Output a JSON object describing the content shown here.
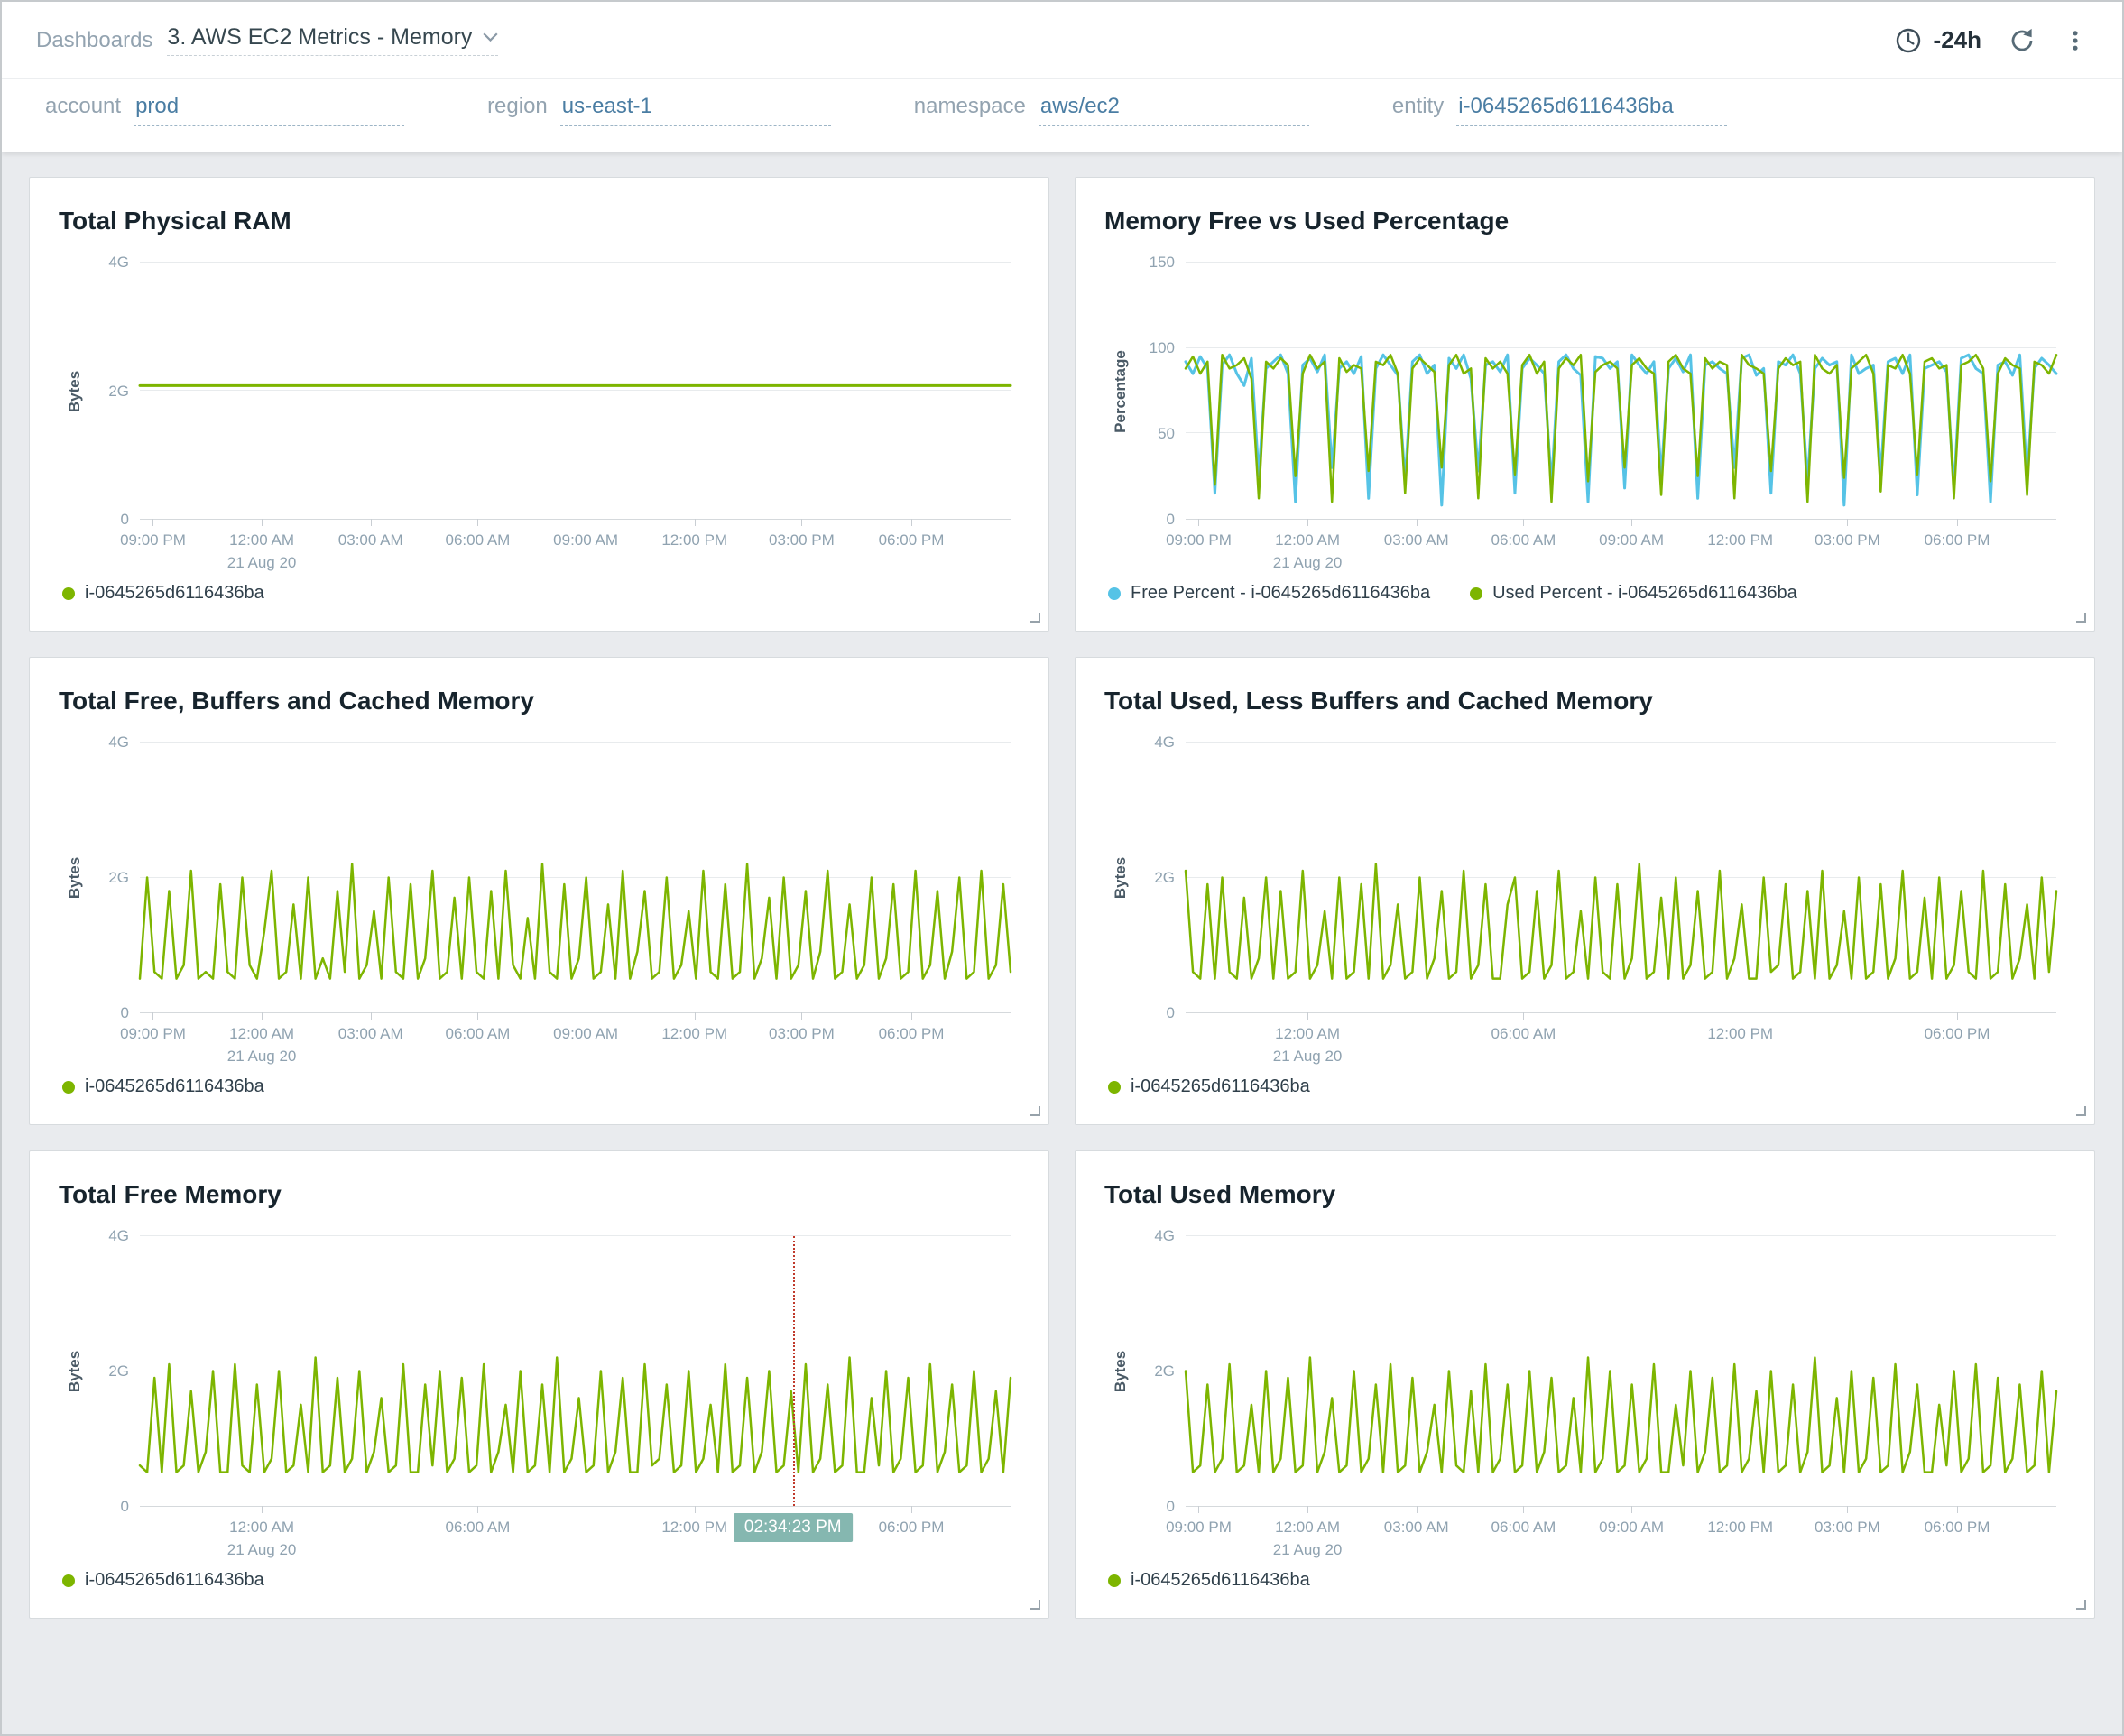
{
  "topbar": {
    "breadcrumb": "Dashboards",
    "dashboard_title": "3. AWS EC2 Metrics - Memory",
    "time_range": "-24h",
    "icons": {
      "time": "clock-icon",
      "refresh": "refresh-icon",
      "menu": "kebab-menu-icon",
      "dropdown": "chevron-down-icon"
    }
  },
  "filters": [
    {
      "label": "account",
      "value": "prod"
    },
    {
      "label": "region",
      "value": "us-east-1"
    },
    {
      "label": "namespace",
      "value": "aws/ec2"
    },
    {
      "label": "entity",
      "value": "i-0645265d6116436ba"
    }
  ],
  "colors": {
    "series_green": "#7db500",
    "series_blue": "#56c3e6",
    "crosshair_red": "#c0392b",
    "tooltip_teal": "#85b7b0",
    "accent_blue": "#4a7da3"
  },
  "chart_data": [
    {
      "type": "line",
      "title": "Total Physical RAM",
      "ylabel": "Bytes",
      "ylim": [
        0,
        4
      ],
      "yticks": [
        {
          "v": 0,
          "label": "0"
        },
        {
          "v": 2,
          "label": "2G"
        },
        {
          "v": 4,
          "label": "4G"
        }
      ],
      "xticks": [
        {
          "frac": 0.015,
          "label": "09:00 PM"
        },
        {
          "frac": 0.14,
          "label": "12:00 AM",
          "sub": "21 Aug 20"
        },
        {
          "frac": 0.265,
          "label": "03:00 AM"
        },
        {
          "frac": 0.388,
          "label": "06:00 AM"
        },
        {
          "frac": 0.512,
          "label": "09:00 AM"
        },
        {
          "frac": 0.637,
          "label": "12:00 PM"
        },
        {
          "frac": 0.76,
          "label": "03:00 PM"
        },
        {
          "frac": 0.886,
          "label": "06:00 PM"
        }
      ],
      "series": [
        {
          "name": "i-0645265d6116436ba",
          "color": "#7db500",
          "width": 3,
          "values": [
            2.08,
            2.08,
            2.08,
            2.08,
            2.08,
            2.08,
            2.08,
            2.08,
            2.08,
            2.08,
            2.08,
            2.08,
            2.08
          ]
        }
      ]
    },
    {
      "type": "line",
      "title": "Memory Free vs Used Percentage",
      "ylabel": "Percentage",
      "ylim": [
        0,
        150
      ],
      "yticks": [
        {
          "v": 0,
          "label": "0"
        },
        {
          "v": 50,
          "label": "50"
        },
        {
          "v": 100,
          "label": "100"
        },
        {
          "v": 150,
          "label": "150"
        }
      ],
      "xticks": [
        {
          "frac": 0.015,
          "label": "09:00 PM"
        },
        {
          "frac": 0.14,
          "label": "12:00 AM",
          "sub": "21 Aug 20"
        },
        {
          "frac": 0.265,
          "label": "03:00 AM"
        },
        {
          "frac": 0.388,
          "label": "06:00 AM"
        },
        {
          "frac": 0.512,
          "label": "09:00 AM"
        },
        {
          "frac": 0.637,
          "label": "12:00 PM"
        },
        {
          "frac": 0.76,
          "label": "03:00 PM"
        },
        {
          "frac": 0.886,
          "label": "06:00 PM"
        }
      ],
      "series": [
        {
          "name": "Free Percent - i-0645265d6116436ba",
          "color": "#56c3e6",
          "width": 3,
          "values": [
            92,
            85,
            95,
            88,
            15,
            90,
            96,
            85,
            78,
            94,
            25,
            88,
            92,
            96,
            85,
            10,
            90,
            94,
            86,
            96,
            30,
            88,
            92,
            85,
            95,
            12,
            88,
            96,
            90,
            84,
            22,
            92,
            96,
            85,
            90,
            8,
            94,
            88,
            96,
            82,
            28,
            90,
            92,
            86,
            96,
            15,
            88,
            94,
            90,
            85,
            20,
            92,
            96,
            88,
            84,
            10,
            95,
            94,
            88,
            92,
            18,
            96,
            90,
            85,
            92,
            25,
            88,
            94,
            86,
            96,
            12,
            90,
            92,
            88,
            85,
            30,
            94,
            96,
            84,
            88,
            15,
            92,
            90,
            96,
            85,
            22,
            88,
            94,
            90,
            92,
            8,
            96,
            85,
            88,
            90,
            26,
            92,
            94,
            85,
            96,
            14,
            88,
            90,
            92,
            86,
            18,
            94,
            96,
            88,
            85,
            10,
            90,
            92,
            84,
            96,
            24,
            88,
            94,
            90,
            85
          ]
        },
        {
          "name": "Used Percent - i-0645265d6116436ba",
          "color": "#7db500",
          "width": 2.5,
          "values": [
            88,
            95,
            85,
            92,
            20,
            96,
            88,
            90,
            94,
            82,
            12,
            92,
            88,
            94,
            90,
            25,
            85,
            96,
            88,
            92,
            10,
            94,
            86,
            90,
            88,
            28,
            92,
            90,
            96,
            85,
            15,
            88,
            94,
            90,
            86,
            30,
            90,
            96,
            85,
            88,
            12,
            94,
            88,
            92,
            85,
            26,
            90,
            96,
            85,
            92,
            10,
            88,
            94,
            90,
            96,
            22,
            86,
            90,
            92,
            88,
            30,
            90,
            94,
            88,
            85,
            14,
            92,
            96,
            88,
            85,
            25,
            94,
            88,
            92,
            90,
            12,
            96,
            90,
            88,
            85,
            28,
            88,
            94,
            90,
            92,
            10,
            96,
            88,
            85,
            90,
            24,
            88,
            92,
            96,
            85,
            16,
            90,
            88,
            96,
            85,
            26,
            92,
            94,
            88,
            90,
            12,
            90,
            92,
            96,
            88,
            22,
            85,
            94,
            90,
            88,
            14,
            92,
            90,
            85,
            96
          ]
        }
      ]
    },
    {
      "type": "line",
      "title": "Total Free, Buffers and Cached Memory",
      "ylabel": "Bytes",
      "ylim": [
        0,
        4
      ],
      "yticks": [
        {
          "v": 0,
          "label": "0"
        },
        {
          "v": 2,
          "label": "2G"
        },
        {
          "v": 4,
          "label": "4G"
        }
      ],
      "xticks": [
        {
          "frac": 0.015,
          "label": "09:00 PM"
        },
        {
          "frac": 0.14,
          "label": "12:00 AM",
          "sub": "21 Aug 20"
        },
        {
          "frac": 0.265,
          "label": "03:00 AM"
        },
        {
          "frac": 0.388,
          "label": "06:00 AM"
        },
        {
          "frac": 0.512,
          "label": "09:00 AM"
        },
        {
          "frac": 0.637,
          "label": "12:00 PM"
        },
        {
          "frac": 0.76,
          "label": "03:00 PM"
        },
        {
          "frac": 0.886,
          "label": "06:00 PM"
        }
      ],
      "series": [
        {
          "name": "i-0645265d6116436ba",
          "color": "#7db500",
          "width": 2.5,
          "values": [
            0.5,
            2.0,
            0.6,
            0.5,
            1.8,
            0.5,
            0.7,
            2.1,
            0.5,
            0.6,
            0.5,
            1.9,
            0.6,
            0.5,
            2.0,
            0.7,
            0.5,
            1.2,
            2.1,
            0.5,
            0.6,
            1.6,
            0.5,
            2.0,
            0.5,
            0.8,
            0.5,
            1.8,
            0.6,
            2.2,
            0.5,
            0.7,
            1.5,
            0.5,
            2.0,
            0.6,
            0.5,
            1.9,
            0.5,
            0.8,
            2.1,
            0.5,
            0.6,
            1.7,
            0.5,
            2.0,
            0.6,
            0.5,
            1.8,
            0.5,
            2.1,
            0.7,
            0.5,
            1.4,
            0.5,
            2.2,
            0.6,
            0.5,
            1.9,
            0.5,
            0.8,
            2.0,
            0.5,
            0.6,
            1.6,
            0.5,
            2.1,
            0.5,
            0.9,
            1.8,
            0.5,
            0.6,
            2.0,
            0.5,
            0.7,
            1.5,
            0.5,
            2.1,
            0.6,
            0.5,
            1.9,
            0.5,
            0.6,
            2.2,
            0.5,
            0.8,
            1.7,
            0.5,
            2.0,
            0.5,
            0.7,
            1.8,
            0.5,
            0.9,
            2.1,
            0.5,
            0.6,
            1.6,
            0.5,
            0.7,
            2.0,
            0.5,
            0.8,
            1.9,
            0.5,
            0.6,
            2.1,
            0.5,
            0.7,
            1.8,
            0.5,
            0.9,
            2.0,
            0.5,
            0.6,
            2.1,
            0.5,
            0.7,
            1.9,
            0.6
          ]
        }
      ]
    },
    {
      "type": "line",
      "title": "Total Used, Less Buffers and Cached Memory",
      "ylabel": "Bytes",
      "ylim": [
        0,
        4
      ],
      "yticks": [
        {
          "v": 0,
          "label": "0"
        },
        {
          "v": 2,
          "label": "2G"
        },
        {
          "v": 4,
          "label": "4G"
        }
      ],
      "xticks": [
        {
          "frac": 0.14,
          "label": "12:00 AM",
          "sub": "21 Aug 20"
        },
        {
          "frac": 0.388,
          "label": "06:00 AM"
        },
        {
          "frac": 0.637,
          "label": "12:00 PM"
        },
        {
          "frac": 0.886,
          "label": "06:00 PM"
        }
      ],
      "series": [
        {
          "name": "i-0645265d6116436ba",
          "color": "#7db500",
          "width": 2.5,
          "values": [
            2.1,
            0.6,
            0.5,
            1.9,
            0.5,
            2.0,
            0.6,
            0.5,
            1.7,
            0.5,
            0.8,
            2.0,
            0.5,
            1.8,
            0.5,
            0.6,
            2.1,
            0.5,
            0.7,
            1.5,
            0.5,
            2.0,
            0.5,
            0.6,
            1.9,
            0.5,
            2.2,
            0.5,
            0.7,
            1.6,
            0.5,
            0.6,
            2.0,
            0.5,
            0.8,
            1.8,
            0.5,
            0.6,
            2.1,
            0.5,
            0.7,
            1.9,
            0.5,
            0.5,
            1.6,
            2.0,
            0.5,
            0.6,
            1.8,
            0.5,
            0.7,
            2.1,
            0.5,
            0.6,
            1.5,
            0.5,
            2.0,
            0.6,
            0.5,
            1.9,
            0.5,
            0.8,
            2.2,
            0.5,
            0.6,
            1.7,
            0.5,
            2.0,
            0.5,
            0.7,
            1.8,
            0.5,
            0.6,
            2.1,
            0.5,
            0.8,
            1.6,
            0.5,
            0.5,
            2.0,
            0.6,
            0.7,
            1.9,
            0.5,
            0.6,
            1.8,
            0.5,
            2.1,
            0.5,
            0.7,
            1.5,
            0.5,
            2.0,
            0.5,
            0.6,
            1.9,
            0.5,
            0.8,
            2.1,
            0.5,
            0.6,
            1.7,
            0.5,
            2.0,
            0.5,
            0.7,
            1.8,
            0.6,
            0.5,
            2.1,
            0.5,
            0.6,
            1.9,
            0.5,
            0.8,
            1.6,
            0.5,
            2.0,
            0.6,
            1.8
          ]
        }
      ]
    },
    {
      "type": "line",
      "title": "Total Free Memory",
      "ylabel": "Bytes",
      "ylim": [
        0,
        4
      ],
      "yticks": [
        {
          "v": 0,
          "label": "0"
        },
        {
          "v": 2,
          "label": "2G"
        },
        {
          "v": 4,
          "label": "4G"
        }
      ],
      "xticks": [
        {
          "frac": 0.14,
          "label": "12:00 AM",
          "sub": "21 Aug 20"
        },
        {
          "frac": 0.388,
          "label": "06:00 AM"
        },
        {
          "frac": 0.637,
          "label": "12:00 PM"
        },
        {
          "frac": 0.886,
          "label": "06:00 PM"
        }
      ],
      "crosshair": {
        "frac": 0.75,
        "label": "02:34:23 PM"
      },
      "series": [
        {
          "name": "i-0645265d6116436ba",
          "color": "#7db500",
          "width": 2.5,
          "values": [
            0.6,
            0.5,
            1.9,
            0.5,
            2.1,
            0.5,
            0.6,
            1.7,
            0.5,
            0.8,
            2.0,
            0.5,
            0.5,
            2.1,
            0.6,
            0.5,
            1.8,
            0.5,
            0.7,
            2.0,
            0.5,
            0.6,
            1.5,
            0.5,
            2.2,
            0.5,
            0.6,
            1.9,
            0.5,
            0.7,
            2.0,
            0.5,
            0.8,
            1.6,
            0.5,
            0.6,
            2.1,
            0.5,
            0.5,
            1.8,
            0.6,
            2.0,
            0.5,
            0.7,
            1.9,
            0.5,
            0.6,
            2.1,
            0.5,
            0.8,
            1.5,
            0.5,
            2.0,
            0.5,
            0.6,
            1.8,
            0.5,
            2.2,
            0.5,
            0.7,
            1.6,
            0.5,
            0.6,
            2.0,
            0.5,
            0.8,
            1.9,
            0.5,
            0.5,
            2.1,
            0.6,
            0.7,
            1.8,
            0.5,
            0.6,
            2.0,
            0.5,
            0.7,
            1.5,
            0.5,
            2.1,
            0.5,
            0.6,
            1.9,
            0.5,
            0.8,
            2.0,
            0.5,
            0.6,
            1.7,
            0.5,
            2.1,
            0.5,
            0.7,
            1.8,
            0.5,
            0.6,
            2.2,
            0.5,
            0.5,
            1.6,
            0.6,
            2.0,
            0.5,
            0.7,
            1.9,
            0.5,
            0.6,
            2.1,
            0.5,
            0.8,
            1.8,
            0.5,
            0.6,
            2.0,
            0.5,
            0.7,
            1.7,
            0.5,
            1.9
          ]
        }
      ]
    },
    {
      "type": "line",
      "title": "Total Used Memory",
      "ylabel": "Bytes",
      "ylim": [
        0,
        4
      ],
      "yticks": [
        {
          "v": 0,
          "label": "0"
        },
        {
          "v": 2,
          "label": "2G"
        },
        {
          "v": 4,
          "label": "4G"
        }
      ],
      "xticks": [
        {
          "frac": 0.015,
          "label": "09:00 PM"
        },
        {
          "frac": 0.14,
          "label": "12:00 AM",
          "sub": "21 Aug 20"
        },
        {
          "frac": 0.265,
          "label": "03:00 AM"
        },
        {
          "frac": 0.388,
          "label": "06:00 AM"
        },
        {
          "frac": 0.512,
          "label": "09:00 AM"
        },
        {
          "frac": 0.637,
          "label": "12:00 PM"
        },
        {
          "frac": 0.76,
          "label": "03:00 PM"
        },
        {
          "frac": 0.886,
          "label": "06:00 PM"
        }
      ],
      "series": [
        {
          "name": "i-0645265d6116436ba",
          "color": "#7db500",
          "width": 2.5,
          "values": [
            2.0,
            0.5,
            0.6,
            1.8,
            0.5,
            0.7,
            2.1,
            0.5,
            0.6,
            1.5,
            0.5,
            2.0,
            0.5,
            0.7,
            1.9,
            0.5,
            0.6,
            2.2,
            0.5,
            0.8,
            1.6,
            0.5,
            0.6,
            2.0,
            0.5,
            0.7,
            1.8,
            0.5,
            2.1,
            0.5,
            0.6,
            1.9,
            0.5,
            0.8,
            1.5,
            0.5,
            2.0,
            0.6,
            0.5,
            1.7,
            0.5,
            2.1,
            0.5,
            0.7,
            1.8,
            0.5,
            0.6,
            2.0,
            0.5,
            0.8,
            1.9,
            0.5,
            0.6,
            1.6,
            0.5,
            2.2,
            0.5,
            0.7,
            2.0,
            0.5,
            0.6,
            1.8,
            0.5,
            0.7,
            2.1,
            0.5,
            0.5,
            1.5,
            0.6,
            2.0,
            0.5,
            0.8,
            1.9,
            0.5,
            0.6,
            2.1,
            0.5,
            0.7,
            1.7,
            0.5,
            2.0,
            0.5,
            0.6,
            1.8,
            0.5,
            0.8,
            2.2,
            0.5,
            0.6,
            1.6,
            0.5,
            2.0,
            0.5,
            0.7,
            1.9,
            0.5,
            0.6,
            2.1,
            0.5,
            0.8,
            1.8,
            0.5,
            0.5,
            1.5,
            0.6,
            2.0,
            0.5,
            0.7,
            2.1,
            0.5,
            0.6,
            1.9,
            0.5,
            0.7,
            1.8,
            0.5,
            0.6,
            2.0,
            0.5,
            1.7
          ]
        }
      ]
    }
  ]
}
